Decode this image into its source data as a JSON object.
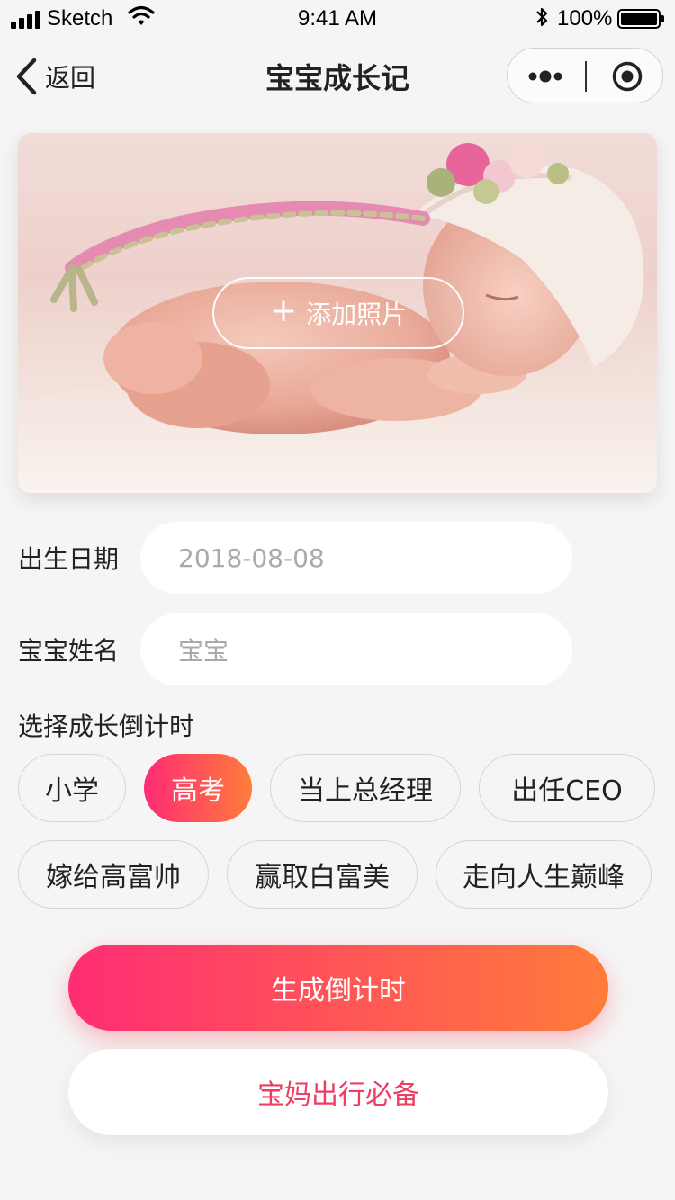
{
  "status_bar": {
    "carrier": "Sketch",
    "time": "9:41 AM",
    "battery": "100%"
  },
  "nav": {
    "back_label": "返回",
    "title": "宝宝成长记"
  },
  "photo": {
    "add_label": "添加照片"
  },
  "form": {
    "birth_label": "出生日期",
    "birth_value": "2018-08-08",
    "name_label": "宝宝姓名",
    "name_value": "宝宝"
  },
  "countdown": {
    "section_label": "选择成长倒计时",
    "tags": [
      {
        "label": "小学",
        "selected": false
      },
      {
        "label": "高考",
        "selected": true
      },
      {
        "label": "当上总经理",
        "selected": false
      },
      {
        "label": "出任CEO",
        "selected": false
      },
      {
        "label": "嫁给高富帅",
        "selected": false
      },
      {
        "label": "赢取白富美",
        "selected": false
      },
      {
        "label": "走向人生巅峰",
        "selected": false
      }
    ]
  },
  "actions": {
    "generate_label": "生成倒计时",
    "essentials_label": "宝妈出行必备"
  },
  "colors": {
    "accent_start": "#ff2d74",
    "accent_end": "#ff7c3a",
    "secondary_text": "#ee3d62",
    "background": "#f5f5f5"
  },
  "icons": {
    "back": "chevron-left-icon",
    "more": "more-dots-icon",
    "home": "target-circle-icon",
    "add": "plus-icon",
    "wifi": "wifi-icon",
    "bluetooth": "bluetooth-icon",
    "battery": "battery-icon",
    "signal": "signal-icon"
  }
}
